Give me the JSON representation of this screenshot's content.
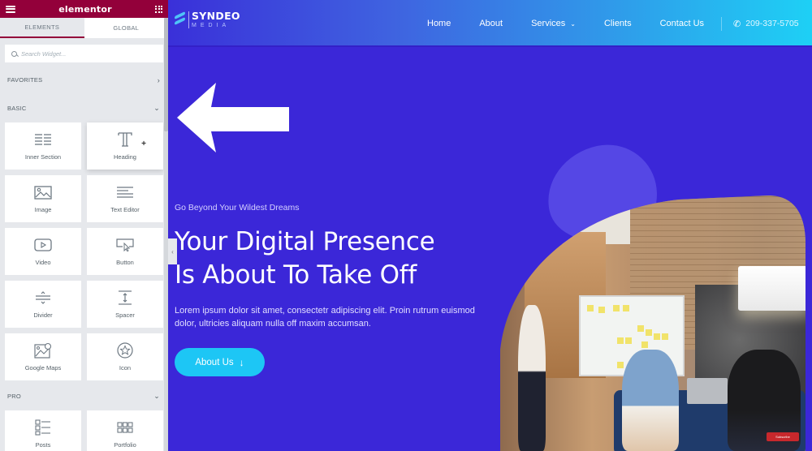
{
  "editor": {
    "logo": "elementor",
    "tabs": [
      {
        "label": "ELEMENTS",
        "active": true
      },
      {
        "label": "GLOBAL",
        "active": false
      }
    ],
    "search": {
      "placeholder": "Search Widget..."
    },
    "categories": {
      "favorites": "FAVORITES",
      "basic": "BASIC",
      "pro": "PRO"
    },
    "basic_widgets": [
      {
        "label": "Inner Section",
        "icon": "inner-section-icon"
      },
      {
        "label": "Heading",
        "icon": "heading-icon"
      },
      {
        "label": "Image",
        "icon": "image-icon"
      },
      {
        "label": "Text Editor",
        "icon": "text-editor-icon"
      },
      {
        "label": "Video",
        "icon": "video-icon"
      },
      {
        "label": "Button",
        "icon": "button-icon"
      },
      {
        "label": "Divider",
        "icon": "divider-icon"
      },
      {
        "label": "Spacer",
        "icon": "spacer-icon"
      },
      {
        "label": "Google Maps",
        "icon": "google-maps-icon"
      },
      {
        "label": "Icon",
        "icon": "star-icon"
      }
    ],
    "pro_widgets": [
      {
        "label": "Posts",
        "icon": "posts-icon"
      },
      {
        "label": "Portfolio",
        "icon": "portfolio-icon"
      }
    ],
    "brand_color": "#93003a"
  },
  "site": {
    "brand": {
      "name": "SYNDEO",
      "sub": "MEDIA"
    },
    "nav": [
      {
        "label": "Home",
        "active": true
      },
      {
        "label": "About",
        "active": false
      },
      {
        "label": "Services",
        "active": false,
        "dropdown": true
      },
      {
        "label": "Clients",
        "active": false
      },
      {
        "label": "Contact Us",
        "active": false
      }
    ],
    "phone": "209-337-5705",
    "hero": {
      "pretitle": "Go Beyond Your Wildest Dreams",
      "title_line1": "Your Digital Presence",
      "title_line2": "Is About To Take Off",
      "body": "Lorem ipsum dolor sit amet, consectetr adipiscing elit. Proin rutrum euismod dolor, ultricies aliquam nulla off  maxim accumsan.",
      "cta": "About Us"
    },
    "video_badge": "Subscribe",
    "accent_color": "#1dc6f5",
    "background_color": "#3b27d8"
  }
}
